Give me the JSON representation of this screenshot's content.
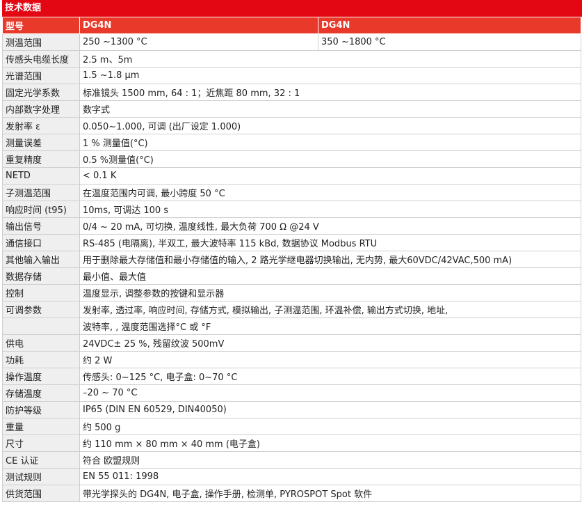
{
  "title": "技术数据",
  "header": {
    "label": "型号",
    "model1": "DG4N",
    "model2": "DG4N"
  },
  "range_row": {
    "label": "测温范围",
    "model1": " 250 ~1300 °C",
    "model2": " 350 ~1800 °C"
  },
  "rows": [
    {
      "label": "传感头电缆长度",
      "value": "2.5 m、5m"
    },
    {
      "label": "光谱范围",
      "value": "1.5 ~1.8 μm"
    },
    {
      "label": "固定光学系数",
      "value": "标准镜头 1500 mm, 64 : 1；近焦距 80 mm, 32 : 1"
    },
    {
      "label": "内部数字处理",
      "value": "数字式"
    },
    {
      "label": "发射率 ε",
      "value": "0.050~1.000, 可调 (出厂设定 1.000)"
    },
    {
      "label": "测量误差",
      "value": " 1 % 测量值(°C)"
    },
    {
      "label": "重复精度",
      "value": "0.5 %测量值(°C)"
    },
    {
      "label": "NETD",
      "value": "< 0.1 K"
    },
    {
      "label": "子测温范围",
      "value": "在温度范围内可调, 最小跨度 50 °C"
    },
    {
      "label": "响应时间 (t95)",
      "value": "10ms, 可调达 100 s"
    },
    {
      "label": "输出信号",
      "value": "0/4 ~ 20 mA, 可切换, 温度线性, 最大负荷 700 Ω @24 V"
    },
    {
      "label": "通信接口",
      "value": "RS-485 (电隔离), 半双工, 最大波特率 115 kBd, 数据协议 Modbus RTU"
    },
    {
      "label": "其他输入输出",
      "value": "用于删除最大存储值和最小存储值的输入, 2 路光学继电器切换输出, 无内势, 最大60VDC/42VAC,500 mA)"
    },
    {
      "label": "数据存储",
      "value": "最小值、最大值"
    },
    {
      "label": "控制",
      "value": "温度显示, 调整参数的按键和显示器"
    },
    {
      "label": "可调参数",
      "value": "发射率, 透过率, 响应时间, 存储方式, 模拟输出, 子测温范围, 环温补偿, 输出方式切换, 地址,"
    },
    {
      "label": "",
      "value": "波特率, , 温度范围选择°C 或 °F"
    },
    {
      "label": "供电",
      "value": "24VDC± 25 %, 残留纹波 500mV"
    },
    {
      "label": "功耗",
      "value": "约 2 W"
    },
    {
      "label": "操作温度",
      "value": "传感头: 0~125 °C, 电子盒: 0~70 °C"
    },
    {
      "label": "存储温度",
      "value": "–20 ~ 70 °C"
    },
    {
      "label": "防护等级",
      "value": "IP65 (DIN EN 60529, DIN40050)"
    },
    {
      "label": "重量",
      "value": " 约 500 g"
    },
    {
      "label": "尺寸",
      "value": " 约 110 mm × 80 mm × 40 mm (电子盒)"
    },
    {
      "label": "CE 认证",
      "value": "符合 欧盟规则"
    },
    {
      "label": "测试规则",
      "value": " EN 55 011: 1998"
    },
    {
      "label": "供货范围",
      "value": "带光学探头的 DG4N, 电子盒, 操作手册, 检测单, PYROSPOT Spot 软件"
    }
  ]
}
